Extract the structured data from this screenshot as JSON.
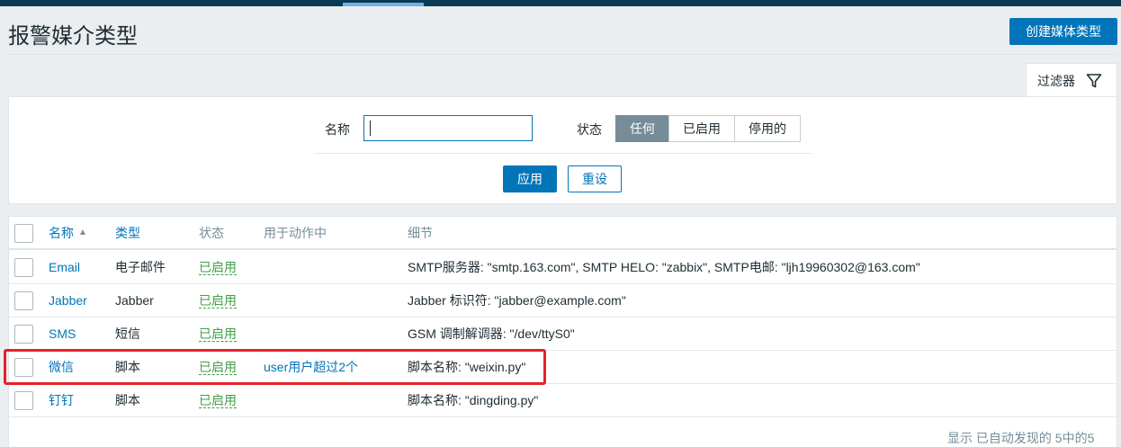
{
  "page": {
    "title": "报警媒介类型",
    "create_label": "创建媒体类型"
  },
  "filter": {
    "tab_label": "过滤器",
    "name_label": "名称",
    "name_value": "",
    "status_label": "状态",
    "status_options": [
      "任何",
      "已启用",
      "停用的"
    ],
    "status_selected": "任何",
    "apply_label": "应用",
    "reset_label": "重设"
  },
  "table": {
    "headers": {
      "name": "名称",
      "type": "类型",
      "status": "状态",
      "used_in_actions": "用于动作中",
      "details": "细节"
    },
    "sort": {
      "column": "name",
      "direction": "ascending"
    },
    "rows": [
      {
        "name": "Email",
        "type": "电子邮件",
        "status": "已启用",
        "action": "",
        "details": "SMTP服务器: \"smtp.163.com\", SMTP HELO: \"zabbix\", SMTP电邮: \"ljh19960302@163.com\""
      },
      {
        "name": "Jabber",
        "type": "Jabber",
        "status": "已启用",
        "action": "",
        "details": "Jabber 标识符: \"jabber@example.com\""
      },
      {
        "name": "SMS",
        "type": "短信",
        "status": "已启用",
        "action": "",
        "details": "GSM 调制解调器: \"/dev/ttyS0\""
      },
      {
        "name": "微信",
        "type": "脚本",
        "status": "已启用",
        "action": "user用户超过2个",
        "details": "脚本名称: \"weixin.py\""
      },
      {
        "name": "钉钉",
        "type": "脚本",
        "status": "已启用",
        "action": "",
        "details": "脚本名称: \"dingding.py\""
      }
    ],
    "footer": "显示 已自动发现的 5中的5"
  },
  "colors": {
    "accent": "#0275b8",
    "enabled": "#429e47",
    "highlight": "#e5212b",
    "topbar": "#0b3a55"
  }
}
